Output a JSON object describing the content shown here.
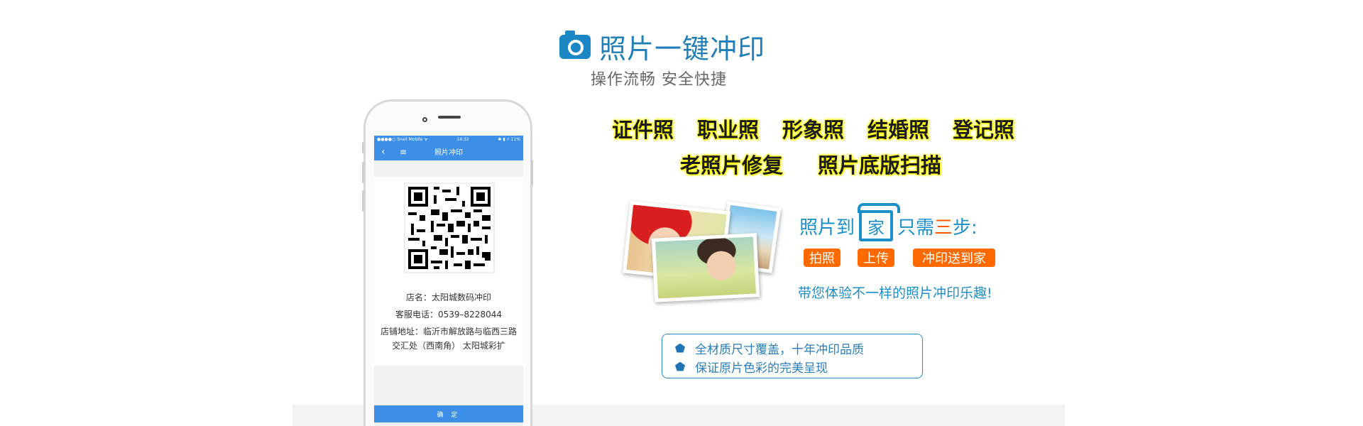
{
  "header": {
    "title": "照片一键冲印",
    "subtitle": "操作流畅 安全快捷"
  },
  "phone": {
    "status": {
      "carrier": "●●●●○ Snail Mobile ᯤ",
      "time": "14:32",
      "battery": "✱ ▮ ⚡ 11%"
    },
    "nav_title": "照片冲印",
    "shop_name": "店名：太阳城数码冲印",
    "shop_phone": "客服电话：0539–8228044",
    "shop_address_line1": "店铺地址：临沂市解放路与临西三路",
    "shop_address_line2": "交汇处（西南角） 太阳城彩扩",
    "confirm_label": "确 定"
  },
  "categories": {
    "row1": [
      "证件照",
      "职业照",
      "形象照",
      "结婚照",
      "登记照"
    ],
    "row2": [
      "老照片修复",
      "照片底版扫描"
    ]
  },
  "steps": {
    "title_part1": "照片到",
    "home_char": "家",
    "title_part2": "只需",
    "title_three": "三",
    "title_part3": "步:",
    "tags": [
      "拍照",
      "上传",
      "冲印送到家"
    ],
    "slogan": "带您体验不一样的照片冲印乐趣!"
  },
  "features": [
    "全材质尺寸覆盖，十年冲印品质",
    "保证原片色彩的完美呈现"
  ],
  "colors": {
    "brand_blue": "#1b8fc8",
    "app_blue": "#3d8ee6",
    "orange": "#ff6a00",
    "highlight": "#ffff00"
  },
  "icons": [
    "camera-icon",
    "home-icon",
    "pentagon-bullet-icon",
    "back-arrow-icon",
    "menu-icon",
    "loading-spinner-icon"
  ]
}
